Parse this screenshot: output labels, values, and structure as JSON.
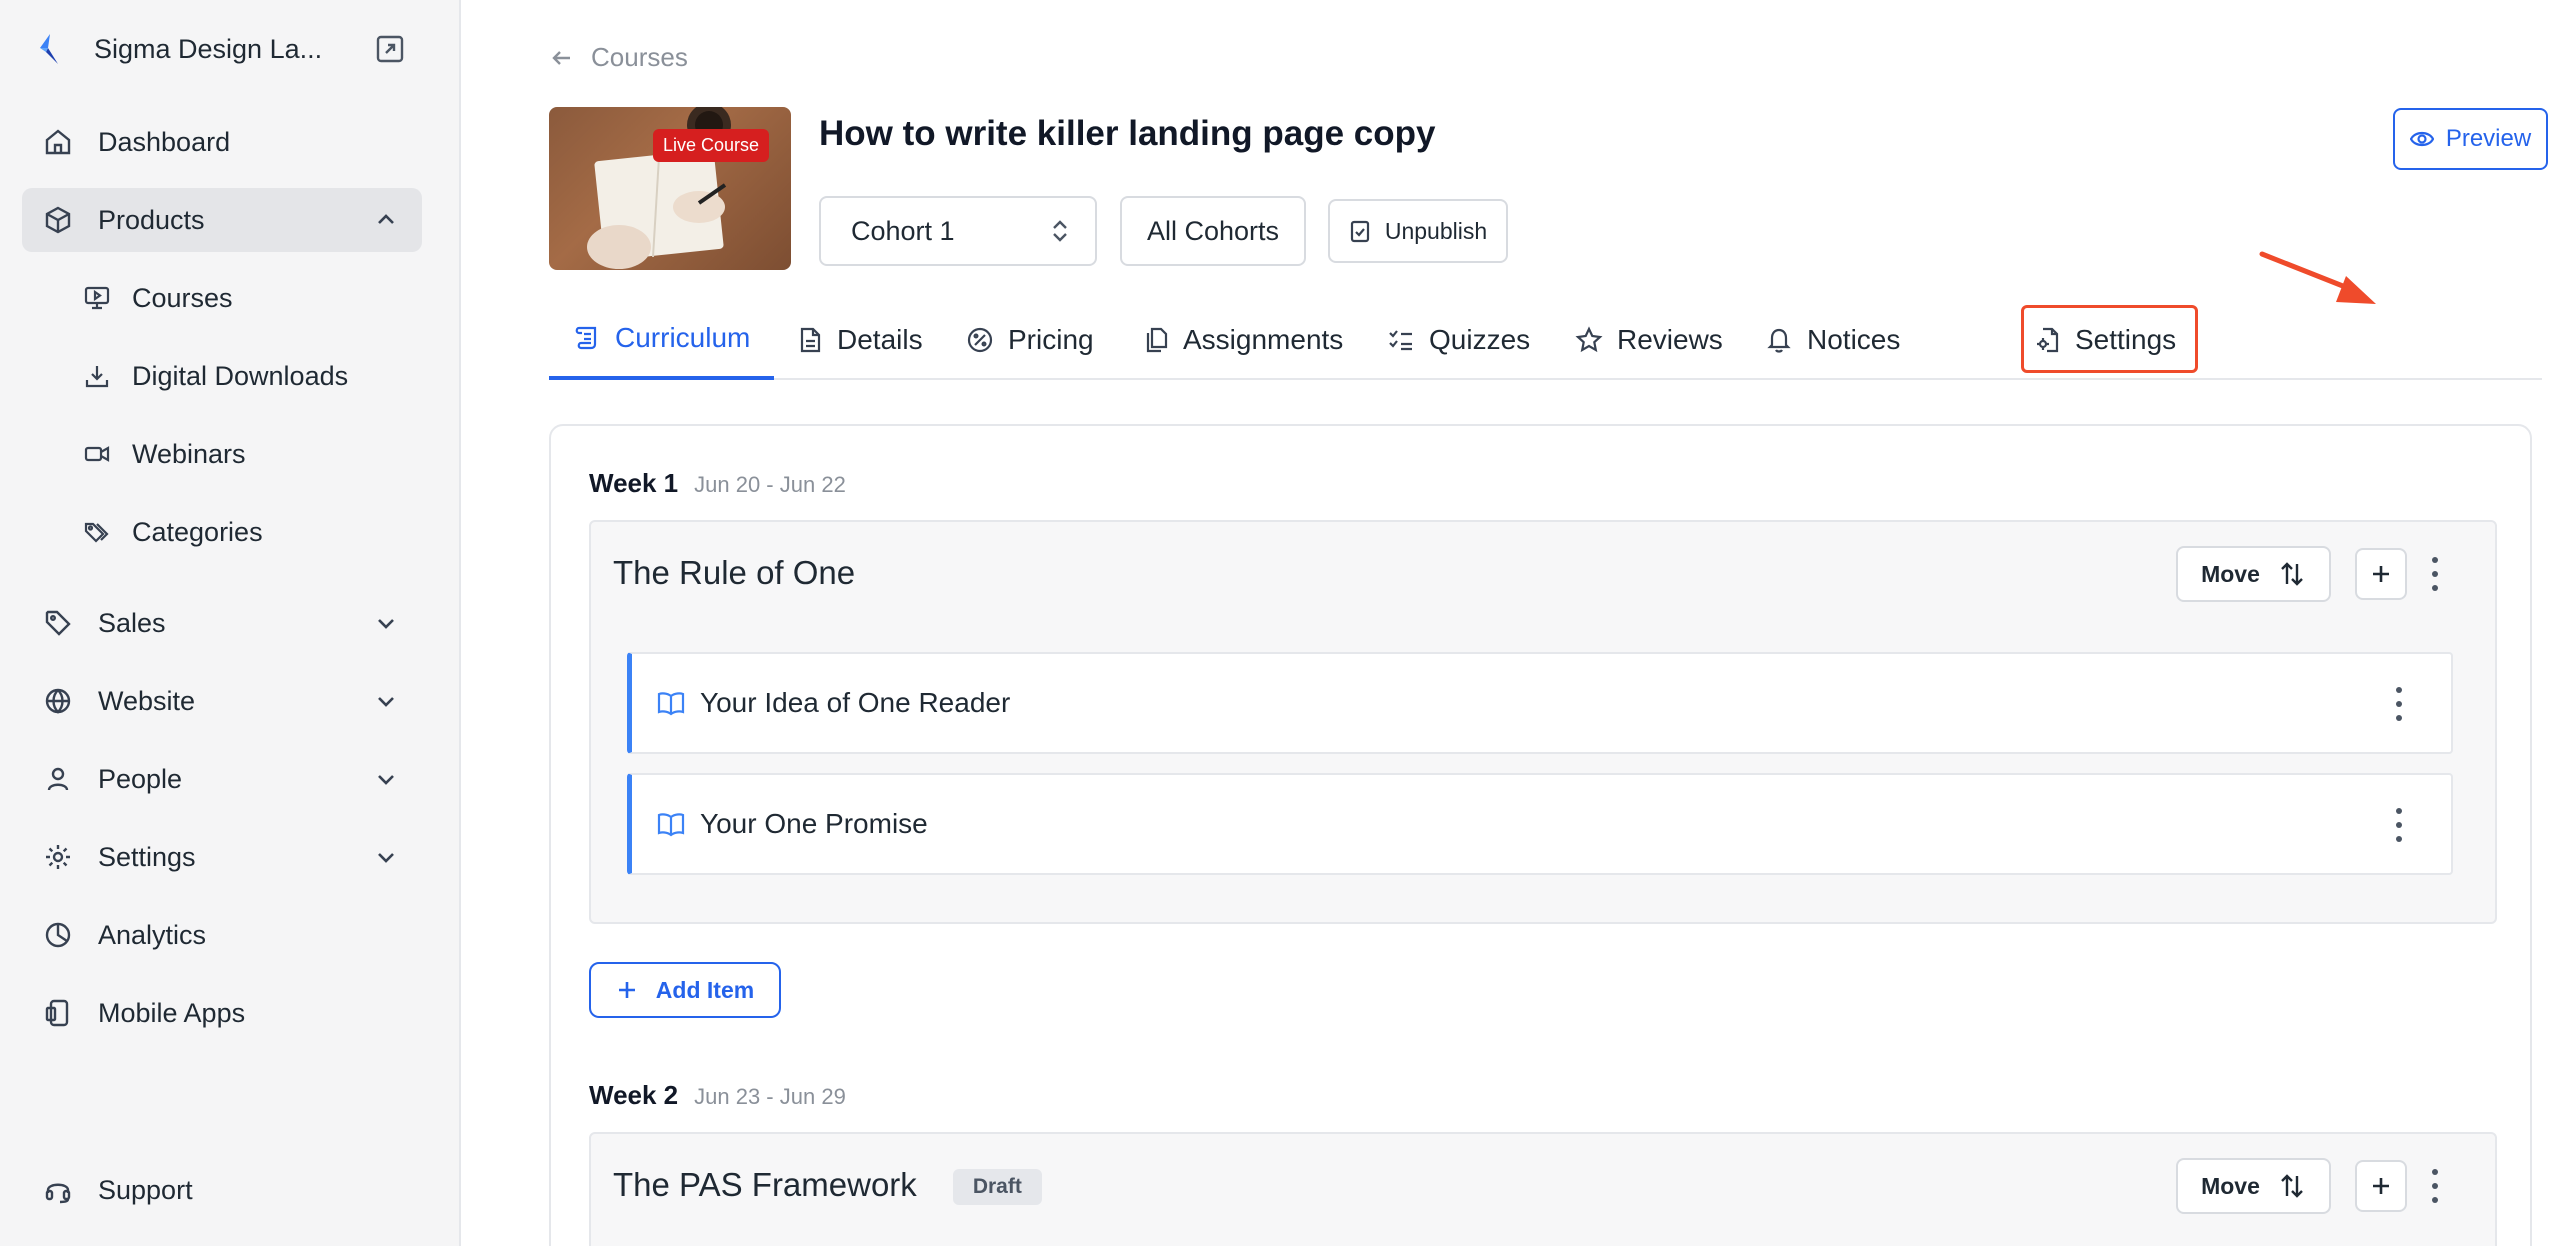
{
  "sidebar": {
    "brand": "Sigma Design La...",
    "nav": [
      {
        "label": "Dashboard",
        "icon": "home-icon"
      },
      {
        "label": "Products",
        "icon": "box-icon",
        "expanded": true
      },
      {
        "label": "Sales",
        "icon": "tag-icon"
      },
      {
        "label": "Website",
        "icon": "globe-icon"
      },
      {
        "label": "People",
        "icon": "user-icon"
      },
      {
        "label": "Settings",
        "icon": "gear-icon"
      },
      {
        "label": "Analytics",
        "icon": "pie-chart-icon"
      },
      {
        "label": "Mobile Apps",
        "icon": "mobile-icon"
      }
    ],
    "products_sub": [
      {
        "label": "Courses",
        "icon": "monitor-play-icon"
      },
      {
        "label": "Digital Downloads",
        "icon": "download-icon"
      },
      {
        "label": "Webinars",
        "icon": "video-icon"
      },
      {
        "label": "Categories",
        "icon": "tags-icon"
      }
    ],
    "support": "Support"
  },
  "breadcrumb": "Courses",
  "course": {
    "badge": "Live Course",
    "title": "How to write killer landing page copy",
    "cohort_select": "Cohort 1",
    "all_cohorts": "All Cohorts",
    "unpublish": "Unpublish",
    "preview": "Preview"
  },
  "tabs": [
    {
      "label": "Curriculum",
      "active": true
    },
    {
      "label": "Details"
    },
    {
      "label": "Pricing"
    },
    {
      "label": "Assignments"
    },
    {
      "label": "Quizzes"
    },
    {
      "label": "Reviews"
    },
    {
      "label": "Notices"
    },
    {
      "label": "Settings",
      "highlighted": true
    }
  ],
  "curriculum": {
    "weeks": [
      {
        "title": "Week 1",
        "dates": "Jun 20 - Jun 22",
        "module": "The Rule of One",
        "lessons": [
          "Your Idea of One Reader",
          "Your One Promise"
        ]
      },
      {
        "title": "Week 2",
        "dates": "Jun 23 - Jun 29",
        "module": "The PAS Framework",
        "status": "Draft"
      }
    ],
    "move_label": "Move",
    "add_item": "Add Item"
  },
  "colors": {
    "accent": "#2563eb",
    "highlight": "#ef4b2b",
    "live_badge": "#d61f1f"
  }
}
